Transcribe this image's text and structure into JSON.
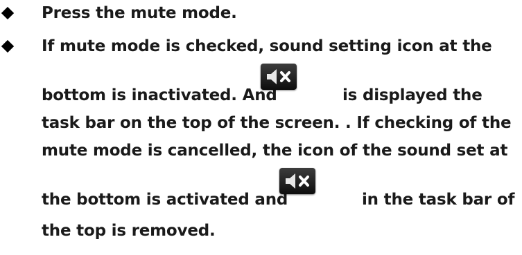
{
  "bullets": [
    {
      "icon": "diamond-bullet",
      "lines": [
        "Press the mute mode."
      ]
    },
    {
      "icon": "diamond-bullet",
      "lines": [
        "If mute mode is checked, sound setting icon at the",
        "bottom is inactivated. And",
        "is displayed the",
        "task bar on the top of the screen. . If checking of the",
        "mute mode is cancelled, the icon of the sound set at",
        "the bottom is activated and",
        "in the task bar of",
        "the top is removed."
      ]
    }
  ],
  "inline_icons": [
    "speaker-mute-icon",
    "speaker-mute-icon"
  ]
}
